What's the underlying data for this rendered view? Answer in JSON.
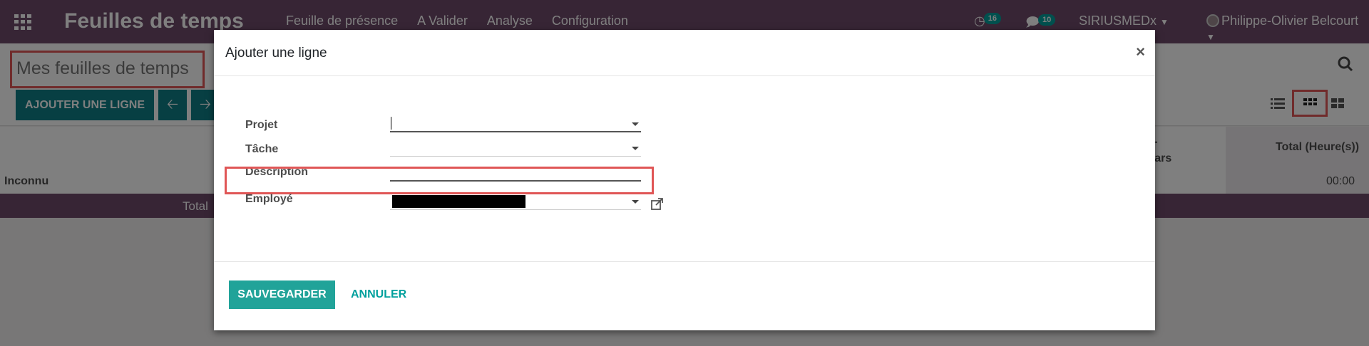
{
  "navbar": {
    "app_title": "Feuilles de temps",
    "menu": [
      "Feuille de présence",
      "A Valider",
      "Analyse",
      "Configuration"
    ],
    "activity_count": "16",
    "message_count": "10",
    "company": "SIRIUSMEDx",
    "user": "Philippe-Olivier Belcourt"
  },
  "control": {
    "breadcrumb": "Mes feuilles de temps",
    "add_line_button": "AJOUTER UNE LIGNE"
  },
  "grid": {
    "date_col": "m.\nmars",
    "total_col": "Total (Heure(s))",
    "rows": [
      {
        "label": "Inconnu",
        "total": "00:00"
      }
    ],
    "footer_label": "Total"
  },
  "modal": {
    "title": "Ajouter une ligne",
    "close": "×",
    "fields": {
      "project": "Projet",
      "task": "Tâche",
      "description": "Description",
      "employee": "Employé"
    },
    "save_button": "SAUVEGARDER",
    "cancel_button": "ANNULER"
  },
  "colors": {
    "navbar": "#6f4a6b",
    "primary": "#00a09d",
    "highlight": "#e05656"
  }
}
